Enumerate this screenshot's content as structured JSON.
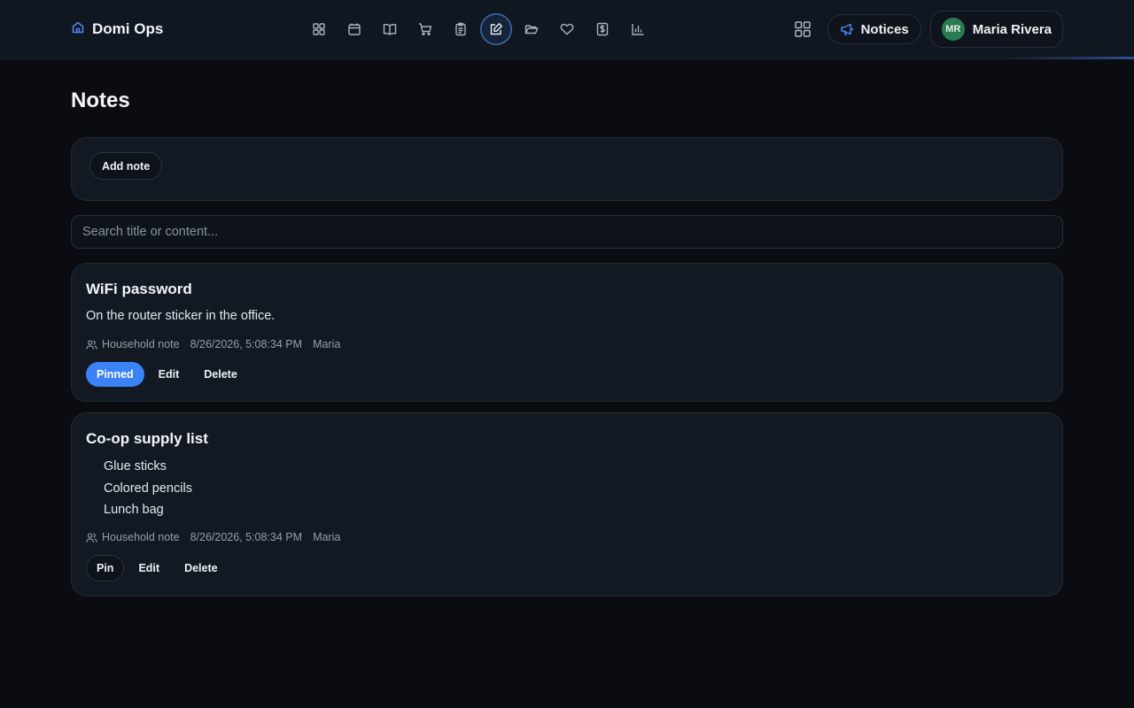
{
  "brand": {
    "name": "Domi Ops",
    "icon": "home-icon"
  },
  "nav": {
    "items": [
      {
        "icon": "dashboard-icon"
      },
      {
        "icon": "calendar-icon"
      },
      {
        "icon": "book-icon"
      },
      {
        "icon": "cart-icon"
      },
      {
        "icon": "clipboard-icon"
      },
      {
        "icon": "notes-edit-icon",
        "active": true
      },
      {
        "icon": "folder-icon"
      },
      {
        "icon": "heart-icon"
      },
      {
        "icon": "dollar-icon"
      },
      {
        "icon": "bar-chart-icon"
      }
    ]
  },
  "header": {
    "notices_label": "Notices",
    "user_initials": "MR",
    "user_name": "Maria Rivera"
  },
  "page": {
    "title": "Notes",
    "add_note_label": "Add note",
    "search_placeholder": "Search title or content..."
  },
  "notes": [
    {
      "title": "WiFi password",
      "content": "On the router sticker in the office.",
      "scope": "Household note",
      "timestamp": "8/26/2026, 5:08:34 PM",
      "author": "Maria",
      "pin_label": "Pinned",
      "edit_label": "Edit",
      "delete_label": "Delete"
    },
    {
      "title": "Co-op supply list",
      "items": [
        "Glue sticks",
        "Colored pencils",
        "Lunch bag"
      ],
      "scope": "Household note",
      "timestamp": "8/26/2026, 5:08:34 PM",
      "author": "Maria",
      "pin_label": "Pin",
      "edit_label": "Edit",
      "delete_label": "Delete"
    }
  ],
  "colors": {
    "accent": "#3b82f6",
    "background": "#0a0c11",
    "card": "#131922",
    "avatar": "#2a7a52"
  }
}
